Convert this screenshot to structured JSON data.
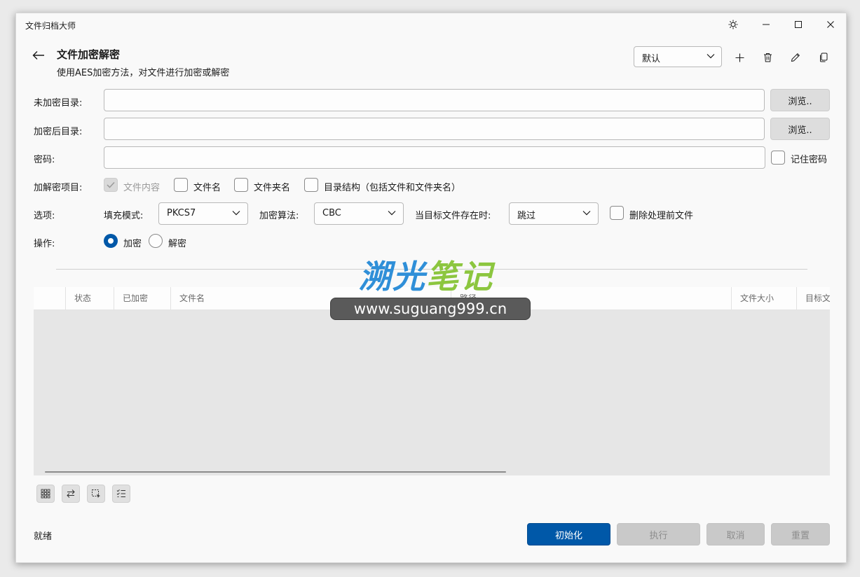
{
  "window": {
    "title": "文件归档大师"
  },
  "header": {
    "title": "文件加密解密",
    "subtitle": "使用AES加密方法，对文件进行加密或解密",
    "preset": "默认"
  },
  "form": {
    "src_dir_label": "未加密目录:",
    "dst_dir_label": "加密后目录:",
    "password_label": "密码:",
    "src_dir_value": "",
    "dst_dir_value": "",
    "password_value": "",
    "browse_label": "浏览..",
    "remember_password": "记住密码",
    "items_label": "加解密项目:",
    "items": {
      "content": "文件内容",
      "filename": "文件名",
      "foldername": "文件夹名",
      "structure": "目录结构（包括文件和文件夹名）"
    },
    "options_label": "选项:",
    "padding_label": "填充模式:",
    "padding_value": "PKCS7",
    "algo_label": "加密算法:",
    "algo_value": "CBC",
    "exists_label": "当目标文件存在时:",
    "exists_value": "跳过",
    "delete_source": "删除处理前文件",
    "operation_label": "操作:",
    "op_encrypt": "加密",
    "op_decrypt": "解密"
  },
  "table": {
    "columns": [
      "状态",
      "已加密",
      "文件名",
      "路径",
      "文件大小",
      "目标文"
    ]
  },
  "footer": {
    "status": "就绪",
    "init": "初始化",
    "execute": "执行",
    "cancel": "取消",
    "reset": "重置"
  },
  "watermark": {
    "title_a": "溯光",
    "title_b": "笔记",
    "url": "www.suguang999.cn"
  },
  "colors": {
    "accent": "#0058a8"
  },
  "icons": {
    "titlebar": [
      "theme-icon",
      "minimize-icon",
      "maximize-icon",
      "close-icon"
    ],
    "header": [
      "back-arrow-icon",
      "add-icon",
      "trash-icon",
      "pencil-icon",
      "copy-icon"
    ],
    "table_tools": [
      "select-all-icon",
      "swap-icon",
      "select-region-icon",
      "checklist-icon"
    ]
  }
}
